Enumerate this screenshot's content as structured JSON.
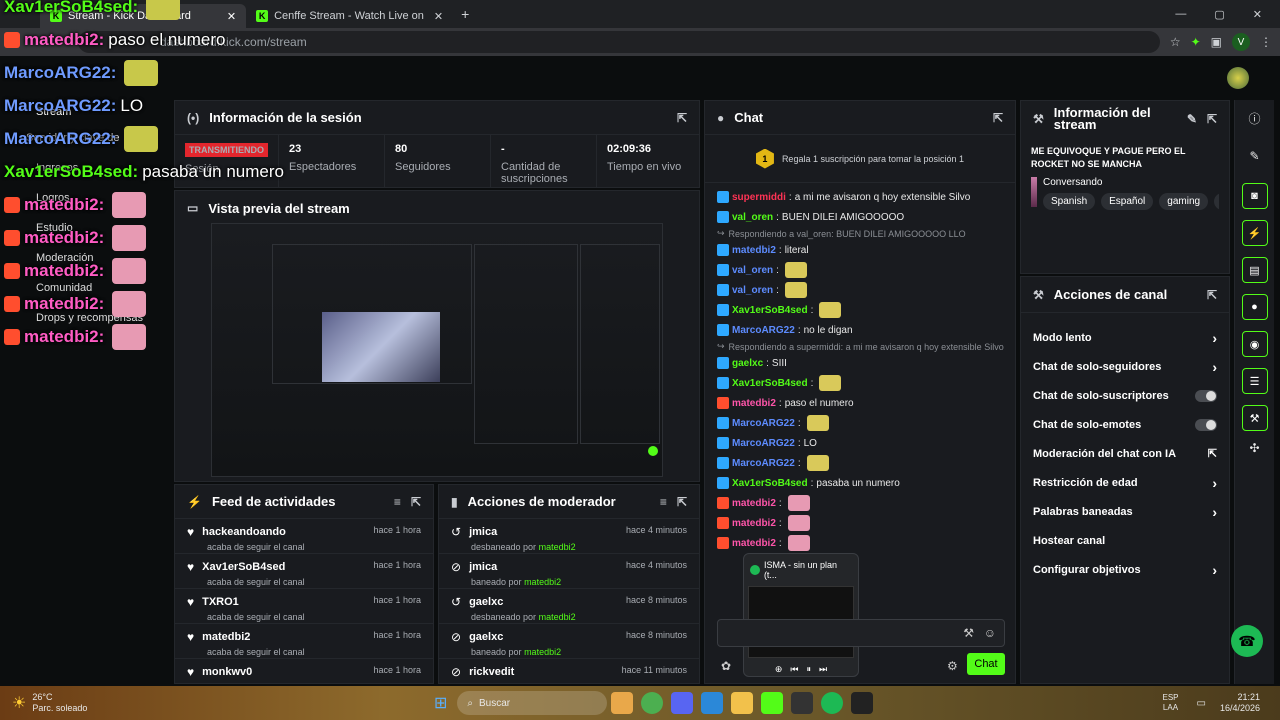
{
  "browser": {
    "tabs": [
      {
        "label": "Stream - Kick Dashboard",
        "active": true
      },
      {
        "label": "Cenffe Stream - Watch Live on",
        "active": false
      }
    ],
    "url": "dashboard.kick.com/stream",
    "profile_initial": "V"
  },
  "overlay": {
    "lines": [
      {
        "user": "Xav1erSoB4sed:",
        "text": "",
        "color": "green"
      },
      {
        "user": "matedbi2:",
        "text": "paso el numero",
        "color": "pink"
      },
      {
        "user": "MarcoARG22:",
        "text": "",
        "color": "blue"
      },
      {
        "user": "MarcoARG22:",
        "text": "LO",
        "color": "blue"
      },
      {
        "user": "MarcoARG22:",
        "text": "",
        "color": "blue"
      },
      {
        "user": "Xav1erSoB4sed:",
        "text": "pasaba un numero",
        "color": "green"
      },
      {
        "user": "matedbi2:",
        "text": "",
        "color": "pink"
      },
      {
        "user": "matedbi2:",
        "text": "",
        "color": "pink"
      },
      {
        "user": "matedbi2:",
        "text": "",
        "color": "pink"
      },
      {
        "user": "matedbi2:",
        "text": "",
        "color": "pink"
      },
      {
        "user": "matedbi2:",
        "text": "",
        "color": "pink"
      }
    ]
  },
  "left_nav": {
    "items": [
      "Stream",
      "Servidor y clave de",
      "Ingresos",
      "Logros",
      "Estudio",
      "Moderación",
      "Comunidad",
      "Drops y recompensas"
    ]
  },
  "session": {
    "title": "Información de la sesión",
    "status_badge": "TRANSMITIENDO",
    "status_label": "Sesión",
    "stats": [
      {
        "value": "23",
        "label": "Espectadores"
      },
      {
        "value": "80",
        "label": "Seguidores"
      },
      {
        "value": "-",
        "label": "Cantidad de suscripciones"
      },
      {
        "value": "02:09:36",
        "label": "Tiempo en vivo"
      }
    ]
  },
  "preview": {
    "title": "Vista previa del stream"
  },
  "feed": {
    "title": "Feed de actividades",
    "items": [
      {
        "name": "hackeandoando",
        "sub": "acaba de seguir el canal",
        "time": "hace 1 hora"
      },
      {
        "name": "Xav1erSoB4sed",
        "sub": "acaba de seguir el canal",
        "time": "hace 1 hora"
      },
      {
        "name": "TXRO1",
        "sub": "acaba de seguir el canal",
        "time": "hace 1 hora"
      },
      {
        "name": "matedbi2",
        "sub": "acaba de seguir el canal",
        "time": "hace 1 hora"
      },
      {
        "name": "monkwv0",
        "sub": "",
        "time": "hace 1 hora"
      }
    ]
  },
  "modactions": {
    "title": "Acciones de moderador",
    "items": [
      {
        "name": "jmica",
        "action": "desbaneado por",
        "by": "matedbi2",
        "time": "hace 4 minutos"
      },
      {
        "name": "jmica",
        "action": "baneado por",
        "by": "matedbi2",
        "time": "hace 4 minutos"
      },
      {
        "name": "gaelxc",
        "action": "desbaneado por",
        "by": "matedbi2",
        "time": "hace 8 minutos"
      },
      {
        "name": "gaelxc",
        "action": "baneado por",
        "by": "matedbi2",
        "time": "hace 8 minutos"
      },
      {
        "name": "rickvedit",
        "action": "",
        "by": "",
        "time": "hace 11 minutos"
      }
    ]
  },
  "chat": {
    "title": "Chat",
    "gift_text": "Regala 1 suscripción para tomar la posición 1",
    "gift_rank": "1",
    "messages": [
      {
        "type": "msg",
        "user": "supermiddi",
        "text": "a mi me avisaron q hoy extensible Silvo",
        "color": "red"
      },
      {
        "type": "msg",
        "user": "val_oren",
        "text": "BUEN DILEI AMIGOOOOO",
        "color": "green"
      },
      {
        "type": "reply",
        "text": "Respondiendo a val_oren: BUEN DILEI AMIGOOOOO LLO"
      },
      {
        "type": "msg",
        "user": "matedbi2",
        "text": "literal",
        "color": "blue"
      },
      {
        "type": "msg",
        "user": "val_oren",
        "text": "",
        "color": "blue"
      },
      {
        "type": "msg",
        "user": "val_oren",
        "text": "",
        "color": "blue"
      },
      {
        "type": "msg",
        "user": "Xav1erSoB4sed",
        "text": "",
        "color": "green"
      },
      {
        "type": "msg",
        "user": "MarcoARG22",
        "text": "no le digan",
        "color": "blue"
      },
      {
        "type": "reply",
        "text": "Respondiendo a supermiddi: a mi me avisaron q hoy extensible Silvo"
      },
      {
        "type": "msg",
        "user": "gaelxc",
        "text": "SIII",
        "color": "green"
      },
      {
        "type": "msg",
        "user": "Xav1erSoB4sed",
        "text": "",
        "color": "green"
      },
      {
        "type": "msg",
        "user": "matedbi2",
        "text": "paso el numero",
        "color": "pink"
      },
      {
        "type": "msg",
        "user": "MarcoARG22",
        "text": "",
        "color": "blue"
      },
      {
        "type": "msg",
        "user": "MarcoARG22",
        "text": "LO",
        "color": "blue"
      },
      {
        "type": "msg",
        "user": "MarcoARG22",
        "text": "",
        "color": "blue"
      },
      {
        "type": "msg",
        "user": "Xav1erSoB4sed",
        "text": "pasaba un numero",
        "color": "green"
      },
      {
        "type": "msg",
        "user": "matedbi2",
        "text": "",
        "color": "pink"
      },
      {
        "type": "msg",
        "user": "matedbi2",
        "text": "",
        "color": "pink"
      },
      {
        "type": "msg",
        "user": "matedbi2",
        "text": "",
        "color": "pink"
      }
    ],
    "send_label": "Chat",
    "spotify_popup": "ISMA - sin un plan (t..."
  },
  "stream_info": {
    "title": "Información del stream",
    "stream_title": "ME EQUIVOQUE Y PAGUE PERO EL ROCKET NO SE MANCHA",
    "category": "Conversando",
    "tags": [
      "Spanish",
      "Español",
      "gaming",
      "je"
    ]
  },
  "channel_actions": {
    "title": "Acciones de canal",
    "items": [
      {
        "label": "Modo lento",
        "control": "chevron"
      },
      {
        "label": "Chat de solo-seguidores",
        "control": "chevron"
      },
      {
        "label": "Chat de solo-suscriptores",
        "control": "toggle"
      },
      {
        "label": "Chat de solo-emotes",
        "control": "toggle"
      },
      {
        "label": "Moderación del chat con IA",
        "control": "external"
      },
      {
        "label": "Restricción de edad",
        "control": "chevron"
      },
      {
        "label": "Palabras baneadas",
        "control": "chevron"
      },
      {
        "label": "Hostear canal",
        "control": "none"
      },
      {
        "label": "Configurar objetivos",
        "control": "chevron"
      }
    ]
  },
  "taskbar": {
    "weather_temp": "26°C",
    "weather_text": "Parc. soleado",
    "search": "Buscar",
    "lang": "ESP",
    "lang2": "LAA",
    "time": "21:21",
    "date": "16/4/2026"
  },
  "colors": {
    "accent": "#53fc18",
    "live": "#e3262d",
    "panel": "#191b1f"
  }
}
